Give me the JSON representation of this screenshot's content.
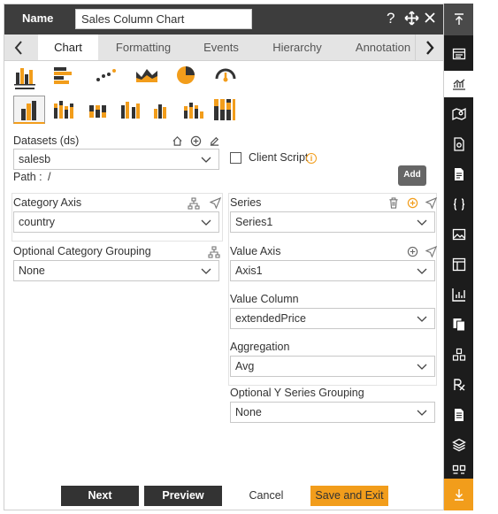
{
  "header": {
    "name_label": "Name",
    "name_value": "Sales Column Chart",
    "help_icon": "question-icon",
    "move_icon": "move-icon",
    "close_icon": "close-icon"
  },
  "tabs": [
    "Chart",
    "Formatting",
    "Events",
    "Hierarchy",
    "Annotation"
  ],
  "active_tab": "Chart",
  "datasets": {
    "label": "Datasets (ds)",
    "value": "salesb",
    "path_label": "Path :",
    "path_value": "/",
    "client_script_label": "Client Script",
    "add_label": "Add"
  },
  "category_axis": {
    "label": "Category Axis",
    "value": "country"
  },
  "category_grouping": {
    "label": "Optional Category Grouping",
    "value": "None"
  },
  "series": {
    "label": "Series",
    "value": "Series1"
  },
  "value_axis": {
    "label": "Value Axis",
    "value": "Axis1"
  },
  "value_column": {
    "label": "Value Column",
    "value": "extendedPrice"
  },
  "aggregation": {
    "label": "Aggregation",
    "value": "Avg"
  },
  "y_grouping": {
    "label": "Optional Y Series Grouping",
    "value": "None"
  },
  "footer": {
    "next": "Next",
    "preview": "Preview",
    "cancel": "Cancel",
    "save_exit": "Save and Exit"
  },
  "colors": {
    "accent": "#f29d1b",
    "dark": "#333333",
    "titlebar": "#3d3d3d",
    "rail": "#1c1c1c"
  }
}
